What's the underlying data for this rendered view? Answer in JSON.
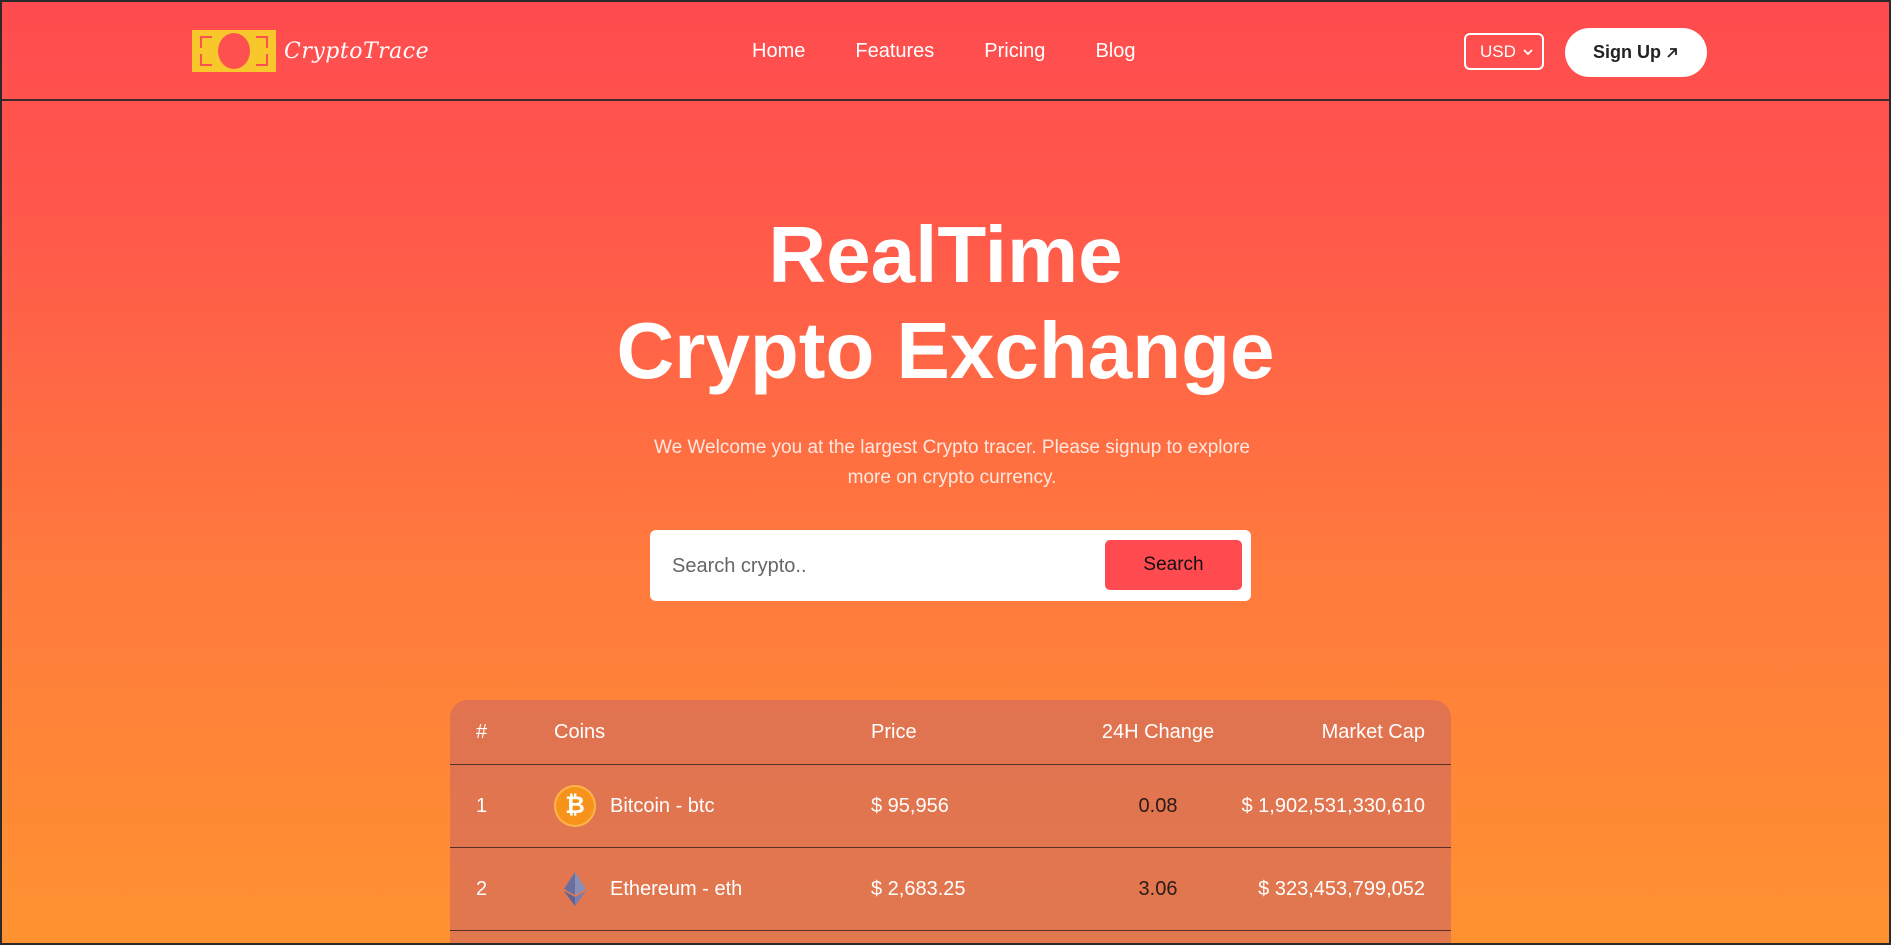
{
  "brand": {
    "name": "CryptoTrace"
  },
  "nav": {
    "items": [
      {
        "label": "Home"
      },
      {
        "label": "Features"
      },
      {
        "label": "Pricing"
      },
      {
        "label": "Blog"
      }
    ],
    "currency": "USD",
    "signup_label": "Sign Up",
    "signup_icon": "arrow-up-right-icon"
  },
  "hero": {
    "title_line1": "RealTime",
    "title_line2": "Crypto Exchange",
    "subtitle": "We Welcome you at the largest Crypto tracer. Please signup to explore more on crypto currency."
  },
  "search": {
    "placeholder": "Search crypto..",
    "value": "",
    "button_label": "Search"
  },
  "table": {
    "headers": {
      "rank": "#",
      "coin": "Coins",
      "price": "Price",
      "change": "24H Change",
      "cap": "Market Cap"
    },
    "rows": [
      {
        "rank": "1",
        "coin": "Bitcoin - btc",
        "icon": "bitcoin-icon",
        "price": "$ 95,956",
        "change": "0.08",
        "cap": "$ 1,902,531,330,610"
      },
      {
        "rank": "2",
        "coin": "Ethereum - eth",
        "icon": "ethereum-icon",
        "price": "$ 2,683.25",
        "change": "3.06",
        "cap": "$ 323,453,799,052"
      }
    ]
  },
  "colors": {
    "accent": "#ff4a50",
    "logo_yellow": "#f7c72c",
    "gradient_top": "#ff4b4f",
    "gradient_bottom": "#ff9230"
  }
}
